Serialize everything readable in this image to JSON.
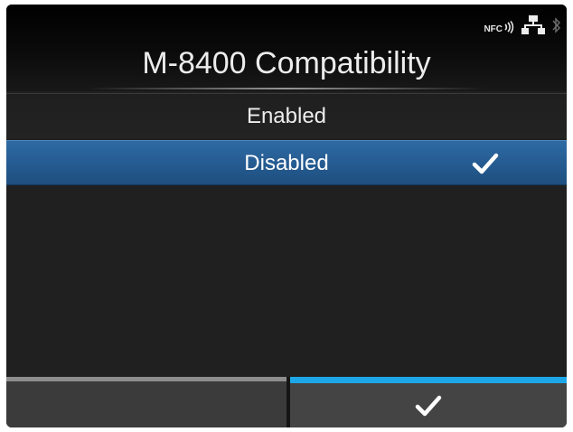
{
  "screen": {
    "title": "M-8400 Compatibility"
  },
  "status_bar": {
    "icons": [
      "nfc-icon",
      "network-icon",
      "bluetooth-icon"
    ],
    "nfc_label": "NFC"
  },
  "options": {
    "items": [
      {
        "label": "Enabled",
        "selected": false
      },
      {
        "label": "Disabled",
        "selected": true
      }
    ]
  },
  "footer": {
    "left_button_label": "",
    "confirm_icon": "checkmark-icon"
  },
  "colors": {
    "selected_row": "#255c92",
    "confirm_accent": "#1da7e8",
    "background": "#202020"
  }
}
